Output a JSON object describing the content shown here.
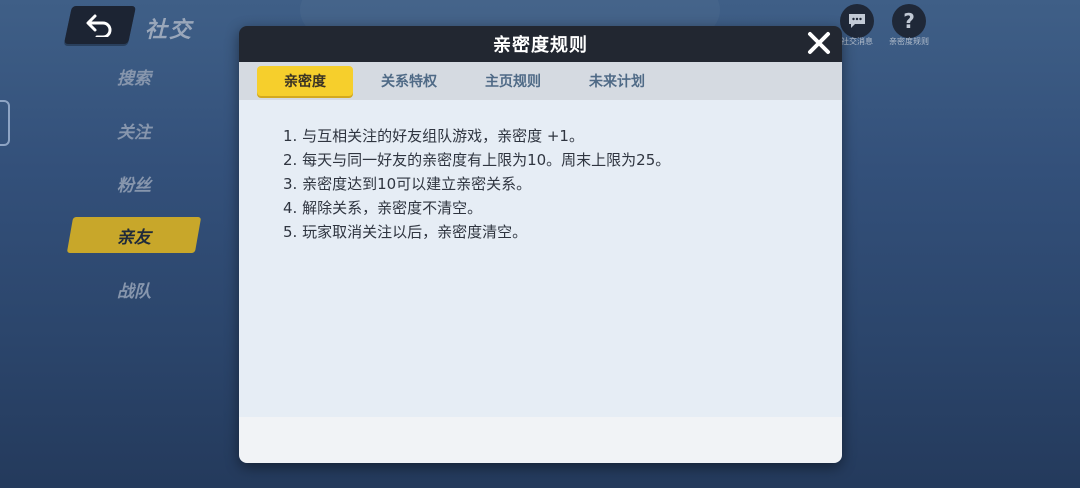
{
  "header": {
    "title": "社交"
  },
  "sidebar": {
    "items": [
      {
        "label": "搜索"
      },
      {
        "label": "关注"
      },
      {
        "label": "粉丝"
      },
      {
        "label": "亲友"
      },
      {
        "label": "战队"
      }
    ],
    "active_index": 3
  },
  "top_icons": {
    "social_messages": "社交消息",
    "intimacy_rules": "亲密度规则"
  },
  "modal": {
    "title": "亲密度规则",
    "tabs": [
      {
        "label": "亲密度"
      },
      {
        "label": "关系特权"
      },
      {
        "label": "主页规则"
      },
      {
        "label": "未来计划"
      }
    ],
    "active_tab": 0,
    "rules": [
      "1. 与互相关注的好友组队游戏，亲密度 +1。",
      "2. 每天与同一好友的亲密度有上限为10。周末上限为25。",
      "3. 亲密度达到10可以建立亲密关系。",
      "4. 解除关系，亲密度不清空。",
      "5. 玩家取消关注以后，亲密度清空。"
    ]
  },
  "colors": {
    "accent_yellow": "#f6cf2c",
    "nav_active": "#c8a72a",
    "modal_header": "#222731",
    "content_bg": "#e6edf5"
  }
}
